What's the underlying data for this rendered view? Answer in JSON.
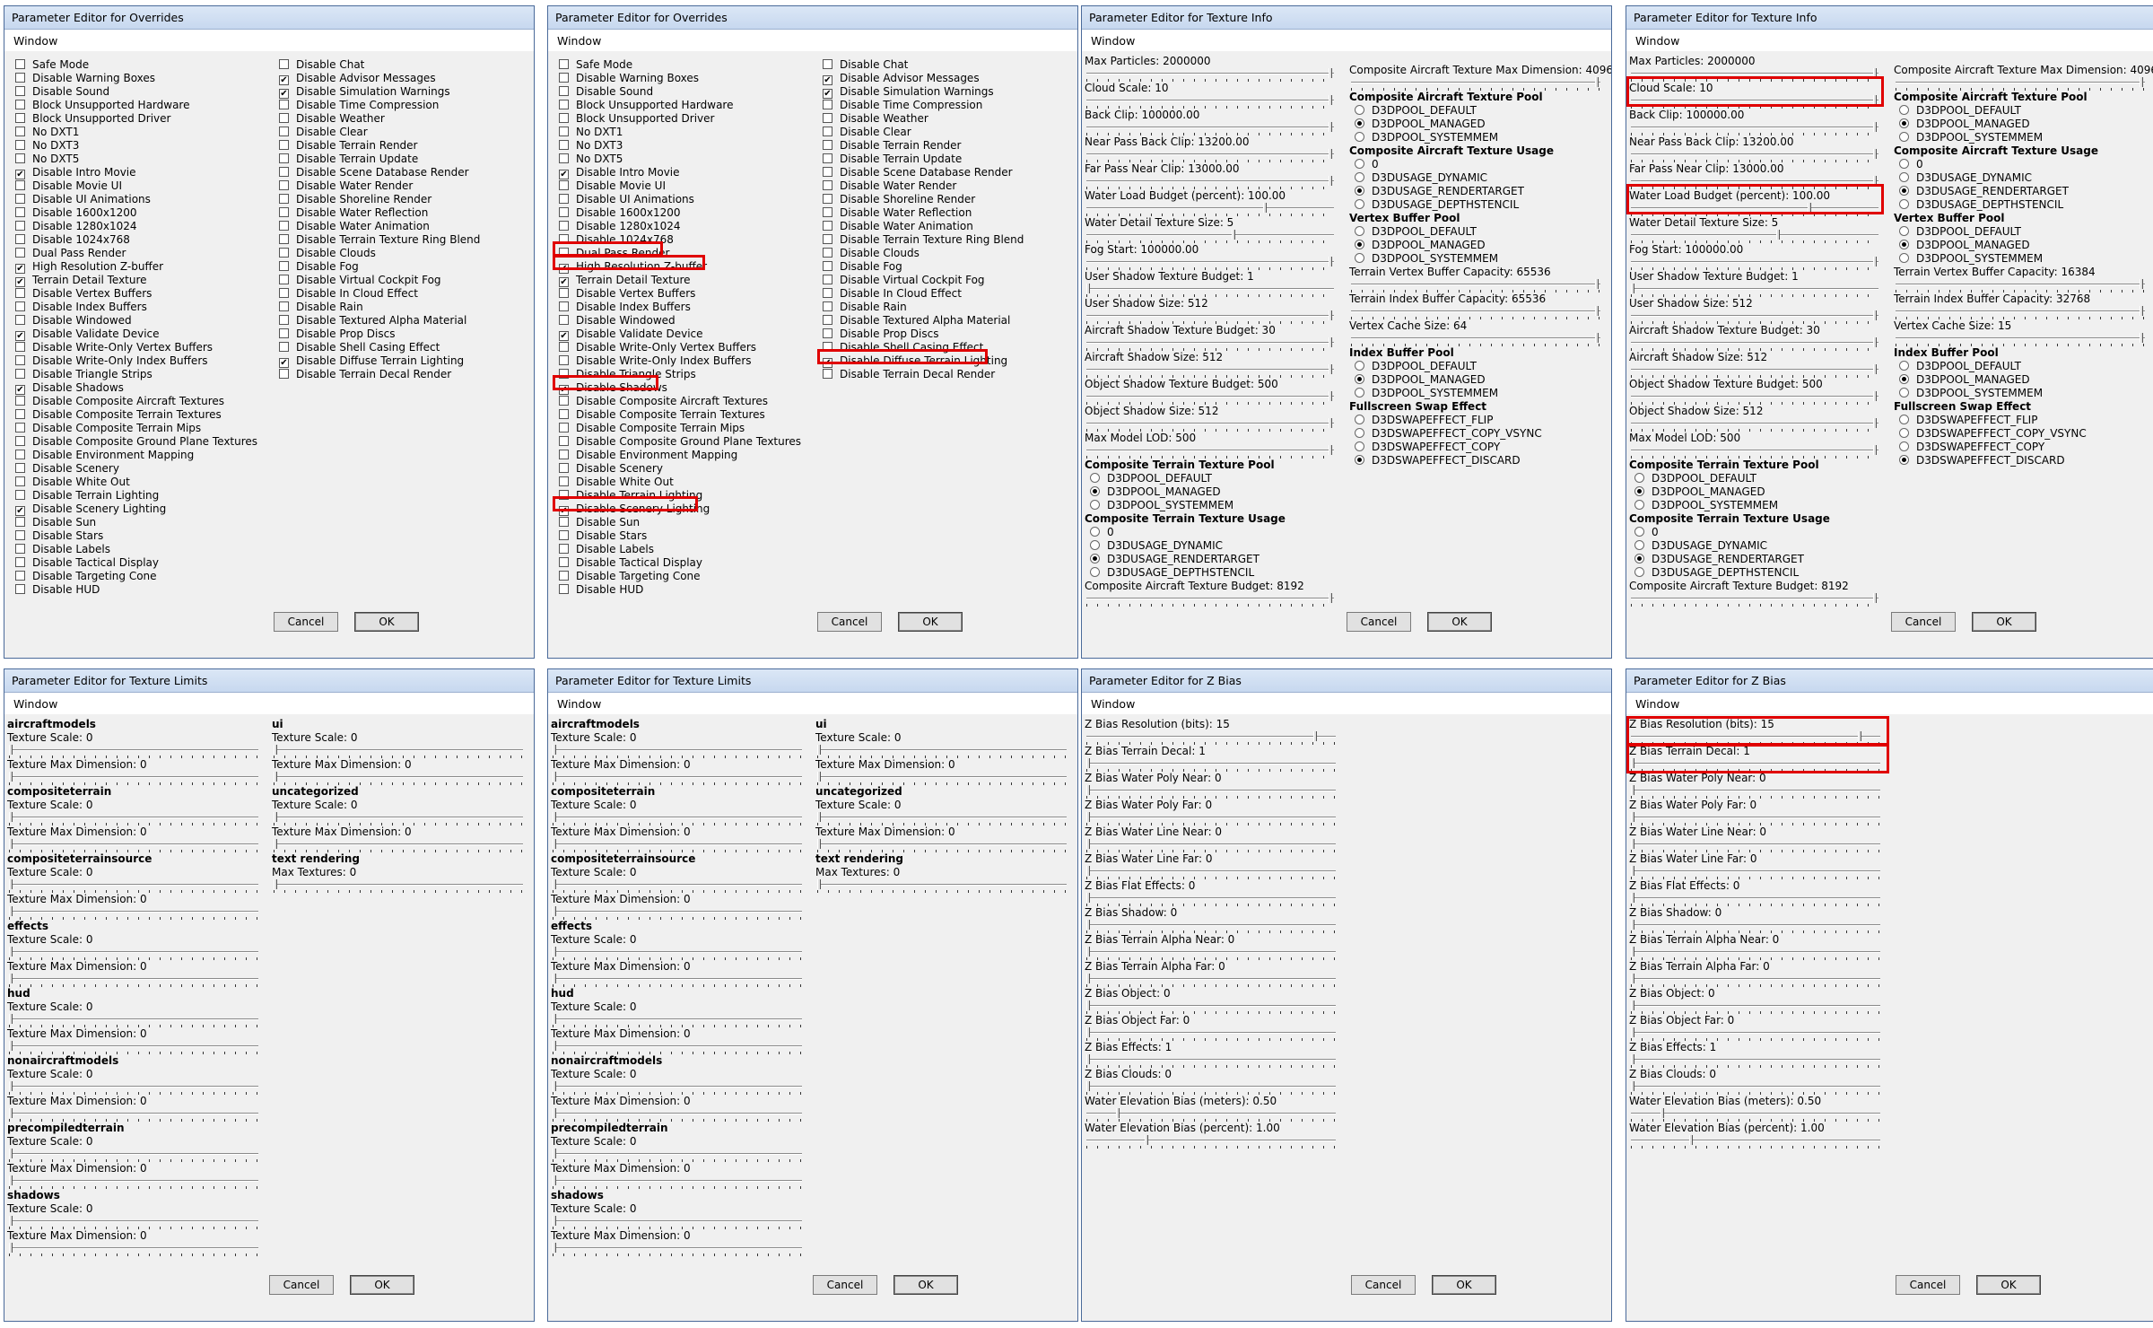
{
  "titles": {
    "overrides": "Parameter Editor for Overrides",
    "texinfo": "Parameter Editor for Texture Info",
    "texlimits": "Parameter Editor for Texture Limits",
    "zbias": "Parameter Editor for Z Bias"
  },
  "menu": "Window",
  "buttons": {
    "cancel": "Cancel",
    "ok": "OK"
  },
  "overrides": {
    "col1": [
      {
        "label": "Safe Mode",
        "checked": false
      },
      {
        "label": "Disable Warning Boxes",
        "checked": false
      },
      {
        "label": "Disable Sound",
        "checked": false
      },
      {
        "label": "Block Unsupported Hardware",
        "checked": false
      },
      {
        "label": "Block Unsupported Driver",
        "checked": false
      },
      {
        "label": "No DXT1",
        "checked": false
      },
      {
        "label": "No DXT3",
        "checked": false
      },
      {
        "label": "No DXT5",
        "checked": false
      },
      {
        "label": "Disable Intro Movie",
        "checked": true
      },
      {
        "label": "Disable Movie UI",
        "checked": false
      },
      {
        "label": "Disable UI Animations",
        "checked": false
      },
      {
        "label": "Disable 1600x1200",
        "checked": false
      },
      {
        "label": "Disable 1280x1024",
        "checked": false
      },
      {
        "label": "Disable 1024x768",
        "checked": false
      },
      {
        "label": "Dual Pass Render",
        "checked": false
      },
      {
        "label": "High Resolution Z-buffer",
        "checked": true
      },
      {
        "label": "Terrain Detail Texture",
        "checked": true
      },
      {
        "label": "Disable Vertex Buffers",
        "checked": false
      },
      {
        "label": "Disable Index Buffers",
        "checked": false
      },
      {
        "label": "Disable Windowed",
        "checked": false
      },
      {
        "label": "Disable Validate Device",
        "checked": true
      },
      {
        "label": "Disable Write-Only Vertex Buffers",
        "checked": false
      },
      {
        "label": "Disable Write-Only Index Buffers",
        "checked": false
      },
      {
        "label": "Disable Triangle Strips",
        "checked": false
      },
      {
        "label": "Disable Shadows",
        "checked": true
      },
      {
        "label": "Disable Composite Aircraft Textures",
        "checked": false
      },
      {
        "label": "Disable Composite Terrain Textures",
        "checked": false
      },
      {
        "label": "Disable Composite Terrain Mips",
        "checked": false
      },
      {
        "label": "Disable Composite Ground Plane Textures",
        "checked": false
      },
      {
        "label": "Disable Environment Mapping",
        "checked": false
      },
      {
        "label": "Disable Scenery",
        "checked": false
      },
      {
        "label": "Disable White Out",
        "checked": false
      },
      {
        "label": "Disable Terrain Lighting",
        "checked": false
      },
      {
        "label": "Disable Scenery Lighting",
        "checked": true
      },
      {
        "label": "Disable Sun",
        "checked": false
      },
      {
        "label": "Disable Stars",
        "checked": false
      },
      {
        "label": "Disable Labels",
        "checked": false
      },
      {
        "label": "Disable Tactical Display",
        "checked": false
      },
      {
        "label": "Disable Targeting Cone",
        "checked": false
      },
      {
        "label": "Disable HUD",
        "checked": false
      }
    ],
    "col2": [
      {
        "label": "Disable Chat",
        "checked": false
      },
      {
        "label": "Disable Advisor Messages",
        "checked": true
      },
      {
        "label": "Disable Simulation Warnings",
        "checked": true
      },
      {
        "label": "Disable Time Compression",
        "checked": false
      },
      {
        "label": "Disable Weather",
        "checked": false
      },
      {
        "label": "Disable Clear",
        "checked": false
      },
      {
        "label": "Disable Terrain Render",
        "checked": false
      },
      {
        "label": "Disable Terrain Update",
        "checked": false
      },
      {
        "label": "Disable Scene Database Render",
        "checked": false
      },
      {
        "label": "Disable Water Render",
        "checked": false
      },
      {
        "label": "Disable Shoreline Render",
        "checked": false
      },
      {
        "label": "Disable Water Reflection",
        "checked": false
      },
      {
        "label": "Disable Water Animation",
        "checked": false
      },
      {
        "label": "Disable Terrain Texture Ring Blend",
        "checked": false
      },
      {
        "label": "Disable Clouds",
        "checked": false
      },
      {
        "label": "Disable Fog",
        "checked": false
      },
      {
        "label": "Disable Virtual Cockpit Fog",
        "checked": false
      },
      {
        "label": "Disable In Cloud Effect",
        "checked": false
      },
      {
        "label": "Disable Rain",
        "checked": false
      },
      {
        "label": "Disable Textured Alpha Material",
        "checked": false
      },
      {
        "label": "Disable Prop Discs",
        "checked": false
      },
      {
        "label": "Disable Shell Casing Effect",
        "checked": false
      },
      {
        "label": "Disable Diffuse Terrain Lighting",
        "checked": true
      },
      {
        "label": "Disable Terrain Decal Render",
        "checked": false
      }
    ]
  },
  "texinfo": {
    "left": [
      {
        "label": "Max Particles: 2000000",
        "thumb": 1.0
      },
      {
        "label": "Cloud Scale: 10",
        "thumb": 1.0
      },
      {
        "label": "Back Clip: 100000.00",
        "thumb": 1.0
      },
      {
        "label": "Near Pass Back Clip: 13200.00",
        "thumb": 1.0
      },
      {
        "label": "Far Pass Near Clip: 13000.00",
        "thumb": 1.0
      },
      {
        "label": "Water Load Budget (percent): 100.00",
        "thumb": 0.73
      },
      {
        "label": "Water Detail Texture Size: 5",
        "thumb": 0.6
      },
      {
        "label": "Fog Start: 100000.00",
        "thumb": 1.0
      },
      {
        "label": "User Shadow Texture Budget: 1",
        "thumb": 0.0
      },
      {
        "label": "User Shadow Size: 512",
        "thumb": 1.0
      },
      {
        "label": "Aircraft Shadow Texture Budget: 30",
        "thumb": 1.0
      },
      {
        "label": "Aircraft Shadow Size: 512",
        "thumb": 1.0
      },
      {
        "label": "Object Shadow Texture Budget: 500",
        "thumb": 1.0
      },
      {
        "label": "Object Shadow Size: 512",
        "thumb": 1.0
      },
      {
        "label": "Max Model LOD: 500",
        "thumb": 1.0
      }
    ],
    "ctp": {
      "title": "Composite Terrain Texture Pool",
      "options": [
        "D3DPOOL_DEFAULT",
        "D3DPOOL_MANAGED",
        "D3DPOOL_SYSTEMMEM"
      ],
      "selected": 1
    },
    "ctu": {
      "title": "Composite Terrain Texture Usage",
      "options": [
        "0",
        "D3DUSAGE_DYNAMIC",
        "D3DUSAGE_RENDERTARGET",
        "D3DUSAGE_DEPTHSTENCIL"
      ],
      "selected": 2
    },
    "cat_budget": {
      "label": "Composite Aircraft Texture Budget: 8192",
      "thumb": 1.0
    },
    "r_top": {
      "label": "Composite Aircraft Texture Max Dimension: 4096",
      "thumb": 1.0
    },
    "catp": {
      "title": "Composite Aircraft Texture Pool",
      "options": [
        "D3DPOOL_DEFAULT",
        "D3DPOOL_MANAGED",
        "D3DPOOL_SYSTEMMEM"
      ],
      "selected": 1
    },
    "catu": {
      "title": "Composite Aircraft Texture Usage",
      "options": [
        "0",
        "D3DUSAGE_DYNAMIC",
        "D3DUSAGE_RENDERTARGET",
        "D3DUSAGE_DEPTHSTENCIL"
      ],
      "selected": 2
    },
    "vbp": {
      "title": "Vertex Buffer Pool",
      "options": [
        "D3DPOOL_DEFAULT",
        "D3DPOOL_MANAGED",
        "D3DPOOL_SYSTEMMEM"
      ],
      "selected": 1
    },
    "tvb": {
      "label": "Terrain Vertex Buffer Capacity: 65536",
      "thumb": 1.0
    },
    "tib": {
      "label": "Terrain Index Buffer Capacity: 65536",
      "thumb": 1.0
    },
    "vcs": {
      "label": "Vertex Cache Size: 64",
      "thumb": 1.0
    },
    "ibp": {
      "title": "Index Buffer Pool",
      "options": [
        "D3DPOOL_DEFAULT",
        "D3DPOOL_MANAGED",
        "D3DPOOL_SYSTEMMEM"
      ],
      "selected": 1
    },
    "fse": {
      "title": "Fullscreen Swap Effect",
      "options": [
        "D3DSWAPEFFECT_FLIP",
        "D3DSWAPEFFECT_COPY_VSYNC",
        "D3DSWAPEFFECT_COPY",
        "D3DSWAPEFFECT_DISCARD"
      ],
      "selected": 3
    }
  },
  "texinfo2": {
    "tvb": "Terrain Vertex Buffer Capacity: 16384",
    "tib": "Terrain Index Buffer Capacity: 32768",
    "vcs": "Vertex Cache Size: 15"
  },
  "texlimits": {
    "left": [
      {
        "name": "aircraftmodels",
        "items": [
          "Texture Scale: 0",
          "Texture Max Dimension: 0"
        ]
      },
      {
        "name": "compositeterrain",
        "items": [
          "Texture Scale: 0",
          "Texture Max Dimension: 0"
        ]
      },
      {
        "name": "compositeterrainsource",
        "items": [
          "Texture Scale: 0",
          "Texture Max Dimension: 0"
        ]
      },
      {
        "name": "effects",
        "items": [
          "Texture Scale: 0",
          "Texture Max Dimension: 0"
        ]
      },
      {
        "name": "hud",
        "items": [
          "Texture Scale: 0",
          "Texture Max Dimension: 0"
        ]
      },
      {
        "name": "nonaircraftmodels",
        "items": [
          "Texture Scale: 0",
          "Texture Max Dimension: 0"
        ]
      },
      {
        "name": "precompiledterrain",
        "items": [
          "Texture Scale: 0",
          "Texture Max Dimension: 0"
        ]
      },
      {
        "name": "shadows",
        "items": [
          "Texture Scale: 0",
          "Texture Max Dimension: 0"
        ]
      }
    ],
    "right": [
      {
        "name": "ui",
        "items": [
          "Texture Scale: 0",
          "Texture Max Dimension: 0"
        ]
      },
      {
        "name": "uncategorized",
        "items": [
          "Texture Scale: 0",
          "Texture Max Dimension: 0"
        ]
      },
      {
        "name": "text rendering",
        "items": [
          "Max Textures: 0"
        ]
      }
    ]
  },
  "zbias": [
    {
      "label": "Z Bias Resolution (bits): 15",
      "thumb": 0.93
    },
    {
      "label": "Z Bias Terrain Decal: 1",
      "thumb": 0.0
    },
    {
      "label": "Z Bias Water Poly Near: 0",
      "thumb": 0.0
    },
    {
      "label": "Z Bias Water Poly Far: 0",
      "thumb": 0.0
    },
    {
      "label": "Z Bias Water Line Near: 0",
      "thumb": 0.0
    },
    {
      "label": "Z Bias Water Line Far: 0",
      "thumb": 0.0
    },
    {
      "label": "Z Bias Flat Effects: 0",
      "thumb": 0.0
    },
    {
      "label": "Z Bias Shadow: 0",
      "thumb": 0.0
    },
    {
      "label": "Z Bias Terrain Alpha Near: 0",
      "thumb": 0.0
    },
    {
      "label": "Z Bias Terrain Alpha Far: 0",
      "thumb": 0.0
    },
    {
      "label": "Z Bias Object: 0",
      "thumb": 0.0
    },
    {
      "label": "Z Bias Object Far: 0",
      "thumb": 0.0
    },
    {
      "label": "Z Bias Effects: 1",
      "thumb": 0.0
    },
    {
      "label": "Z Bias Clouds: 0",
      "thumb": 0.0
    },
    {
      "label": "Water Elevation Bias (meters): 0.50",
      "thumb": 0.12
    },
    {
      "label": "Water Elevation Bias (percent): 1.00",
      "thumb": 0.24
    }
  ],
  "highlight_color": "#e00000"
}
